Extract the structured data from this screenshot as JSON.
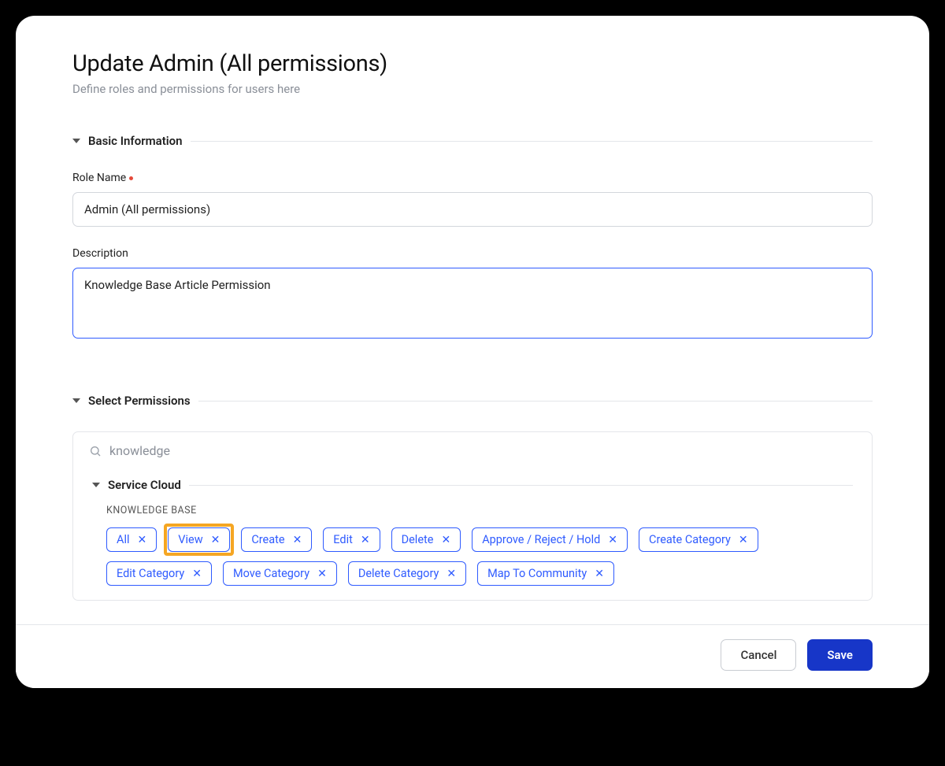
{
  "page": {
    "title": "Update Admin (All permissions)",
    "subtitle": "Define roles and permissions for users here"
  },
  "sections": {
    "basic": {
      "title": "Basic Information"
    },
    "permissions": {
      "title": "Select Permissions"
    }
  },
  "fields": {
    "role_name": {
      "label": "Role Name",
      "value": "Admin (All permissions)"
    },
    "description": {
      "label": "Description",
      "value": "Knowledge Base Article Permission"
    }
  },
  "search": {
    "value": "knowledge"
  },
  "perm_tree": {
    "service_cloud": {
      "title": "Service Cloud",
      "groups": {
        "kb": {
          "label": "KNOWLEDGE BASE",
          "chips": [
            {
              "label": "All"
            },
            {
              "label": "View",
              "highlighted": true
            },
            {
              "label": "Create"
            },
            {
              "label": "Edit"
            },
            {
              "label": "Delete"
            },
            {
              "label": "Approve / Reject / Hold"
            },
            {
              "label": "Create Category"
            },
            {
              "label": "Edit Category"
            },
            {
              "label": "Move Category"
            },
            {
              "label": "Delete Category"
            },
            {
              "label": "Map To Community"
            }
          ]
        }
      }
    }
  },
  "footer": {
    "cancel": "Cancel",
    "save": "Save"
  }
}
